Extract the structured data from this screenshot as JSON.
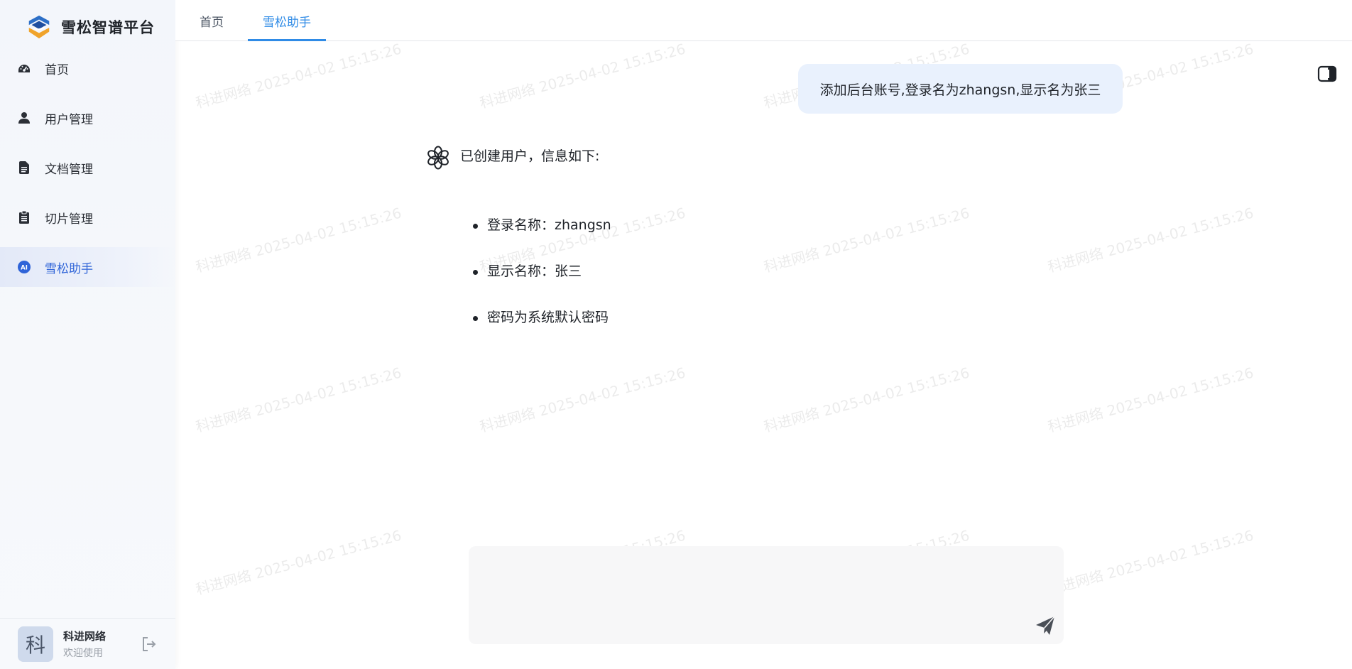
{
  "app": {
    "name": "雪松智谱平台"
  },
  "sidebar": {
    "items": [
      {
        "label": "首页",
        "icon": "dashboard-icon"
      },
      {
        "label": "用户管理",
        "icon": "user-icon"
      },
      {
        "label": "文档管理",
        "icon": "document-icon"
      },
      {
        "label": "切片管理",
        "icon": "clipboard-icon"
      },
      {
        "label": "雪松助手",
        "icon": "ai-icon",
        "active": true
      }
    ]
  },
  "user": {
    "avatar_char": "科",
    "name": "科进网络",
    "subtitle": "欢迎使用"
  },
  "tabs": [
    {
      "label": "首页"
    },
    {
      "label": "雪松助手",
      "active": true
    }
  ],
  "watermark": "科进网络 2025-04-02 15:15:26",
  "chat": {
    "user_message": "添加后台账号,登录名为zhangsn,显示名为张三",
    "assistant_intro": "已创建用户，信息如下:",
    "assistant_items": [
      "登录名称：zhangsn",
      "显示名称：张三",
      "密码为系统默认密码"
    ]
  },
  "composer": {
    "placeholder": ""
  },
  "colors": {
    "accent": "#2f64d8",
    "tab_active": "#2f8be6",
    "user_bubble": "#e9f1fd"
  }
}
